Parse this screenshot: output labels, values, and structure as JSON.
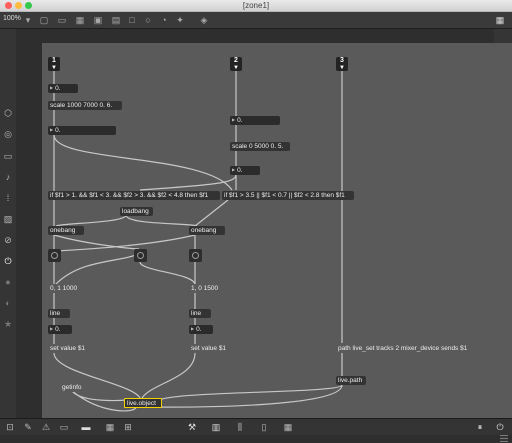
{
  "window": {
    "title": "[zone1]"
  },
  "toolbar": {
    "zoom": "100%"
  },
  "colors": {
    "patcher_bg": "#5a5a5a",
    "selected_outline": "#f2d400",
    "app_bg": "#2e2e2e"
  },
  "inlets": [
    "1",
    "2",
    "3"
  ],
  "objects": {
    "num1": "0.",
    "scale1": "scale 1000 7000 0. 6.",
    "num2": "0.",
    "num3": "0.",
    "scale2": "scale 0 5000 0. 5.",
    "num4": "0.",
    "if1": "if $f1 > 1. && $f1 < 3. && $f2 > 3. && $f2 < 4.8 then $f1",
    "if2": "if $f1 > 3.5 || $f1 < 0.7 || $f2 < 2.8 then $f1",
    "loadbang": "loadbang",
    "onebang1": "onebang",
    "onebang2": "onebang",
    "msg1": "0, 1 1000",
    "msg2": "1, 0 1500",
    "line1": "line",
    "line2": "line",
    "num5": "0.",
    "num6": "0.",
    "set1": "set value $1",
    "set2": "set value $1",
    "path": "path live_set tracks 2 mixer_device sends $1",
    "getinfo": "getinfo",
    "liveobject": "live.object",
    "livepath": "live.path"
  },
  "icons": {
    "toolbar": [
      "lock-icon",
      "window-icon",
      "grid-icon",
      "presentation-icon",
      "layout-icon",
      "box-icon",
      "circle-icon",
      "square-icon",
      "dial-icon",
      "star-icon",
      "paint-icon"
    ],
    "left_sidebar": [
      "cube-icon",
      "target-icon",
      "panel-icon",
      "note-icon",
      "bracket-icon",
      "image-icon",
      "link-icon",
      "plug-icon",
      "info-icon",
      "clock-icon",
      "star-icon"
    ],
    "right_sidebar": [
      "search-icon",
      "info-icon",
      "book-icon",
      "layers-icon",
      "camera-icon",
      "sliders-icon"
    ],
    "status": [
      "lock-icon",
      "edit-icon",
      "warning-icon",
      "presentation-icon",
      "chat-icon",
      "grid-icon",
      "wrench-icon",
      "piano-icon",
      "mixer-icon",
      "tablet-icon",
      "grid-icon",
      "pause-icon",
      "power-icon"
    ]
  }
}
